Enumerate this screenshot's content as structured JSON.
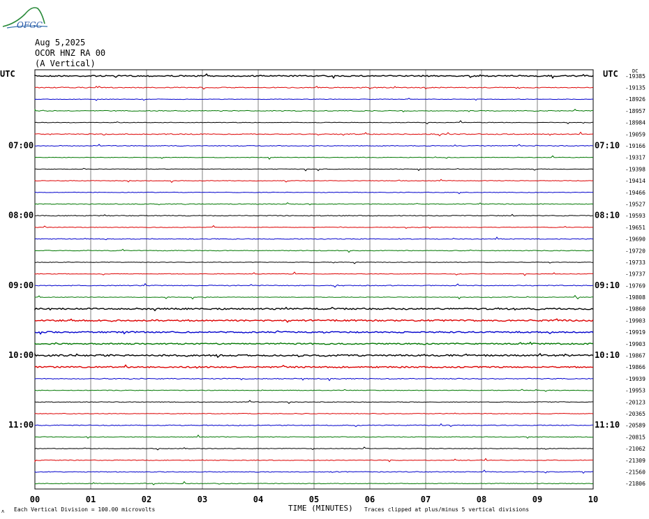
{
  "header": {
    "logo_text": "OFGC",
    "date": "Aug 5,2025",
    "station": "OCOR HNZ RA 00",
    "component": "(A Vertical)"
  },
  "labels": {
    "utc_left": "UTC",
    "utc_right": "UTC",
    "dc_header": "DC",
    "x_axis_title": "TIME (MINUTES)",
    "scale_note": "Each Vertical Division =  100.00 microvolts",
    "clip_note": "Traces clipped at plus/minus 5 vertical divisions",
    "corner_mark": "ʌ"
  },
  "colors": {
    "cycle": [
      "#000000",
      "#dd0000",
      "#0000cc",
      "#007700"
    ],
    "grid": "#808080"
  },
  "chart_data": {
    "type": "line",
    "xlabel": "TIME (MINUTES)",
    "xlim": [
      0,
      10
    ],
    "x_ticks": [
      "00",
      "01",
      "02",
      "03",
      "04",
      "05",
      "06",
      "07",
      "08",
      "09",
      "10"
    ],
    "hour_labels_left": [
      {
        "row": 6,
        "text": "07:00"
      },
      {
        "row": 12,
        "text": "08:00"
      },
      {
        "row": 18,
        "text": "09:00"
      },
      {
        "row": 24,
        "text": "10:00"
      },
      {
        "row": 30,
        "text": "11:00"
      }
    ],
    "hour_labels_right": [
      {
        "row": 6,
        "text": "07:10"
      },
      {
        "row": 12,
        "text": "08:10"
      },
      {
        "row": 18,
        "text": "09:10"
      },
      {
        "row": 24,
        "text": "10:10"
      },
      {
        "row": 30,
        "text": "11:10"
      }
    ],
    "dc_offsets": [
      "-19385",
      "-19135",
      "-18926",
      "-18957",
      "-18984",
      "-19059",
      "-19166",
      "-19317",
      "-19398",
      "-19414",
      "-19466",
      "-19527",
      "-19593",
      "-19651",
      "-19690",
      "-19720",
      "-19733",
      "-19737",
      "-19769",
      "-19808",
      "-19860",
      "-19903",
      "-19919",
      "-19903",
      "-19867",
      "-19866",
      "-19939",
      "-19953",
      "-20123",
      "-20365",
      "-20589",
      "-20815",
      "-21062",
      "-21309",
      "-21560",
      "-21806"
    ],
    "series": [
      {
        "row": 0,
        "activity": 0.7
      },
      {
        "row": 1,
        "activity": 0.4
      },
      {
        "row": 2,
        "activity": 0.1
      },
      {
        "row": 3,
        "activity": 0.3
      },
      {
        "row": 4,
        "activity": 0.1
      },
      {
        "row": 5,
        "activity": 0.4
      },
      {
        "row": 6,
        "activity": 0.3
      },
      {
        "row": 7,
        "activity": 0.1
      },
      {
        "row": 8,
        "activity": 0.1
      },
      {
        "row": 9,
        "activity": 0.1
      },
      {
        "row": 10,
        "activity": 0.1
      },
      {
        "row": 11,
        "activity": 0.3
      },
      {
        "row": 12,
        "activity": 0.3
      },
      {
        "row": 13,
        "activity": 0.1
      },
      {
        "row": 14,
        "activity": 0.3
      },
      {
        "row": 15,
        "activity": 0.2
      },
      {
        "row": 16,
        "activity": 0.1
      },
      {
        "row": 17,
        "activity": 0.1
      },
      {
        "row": 18,
        "activity": 0.3
      },
      {
        "row": 19,
        "activity": 0.1
      },
      {
        "row": 20,
        "activity": 0.9
      },
      {
        "row": 21,
        "activity": 1.0
      },
      {
        "row": 22,
        "activity": 0.8
      },
      {
        "row": 23,
        "activity": 0.7
      },
      {
        "row": 24,
        "activity": 1.0
      },
      {
        "row": 25,
        "activity": 0.8
      },
      {
        "row": 26,
        "activity": 0.4
      },
      {
        "row": 27,
        "activity": 0.2
      },
      {
        "row": 28,
        "activity": 0.2
      },
      {
        "row": 29,
        "activity": 0.2
      },
      {
        "row": 30,
        "activity": 0.3
      },
      {
        "row": 31,
        "activity": 0.2
      },
      {
        "row": 32,
        "activity": 0.2
      },
      {
        "row": 33,
        "activity": 0.2
      },
      {
        "row": 34,
        "activity": 0.3
      },
      {
        "row": 35,
        "activity": 0.2
      }
    ]
  }
}
